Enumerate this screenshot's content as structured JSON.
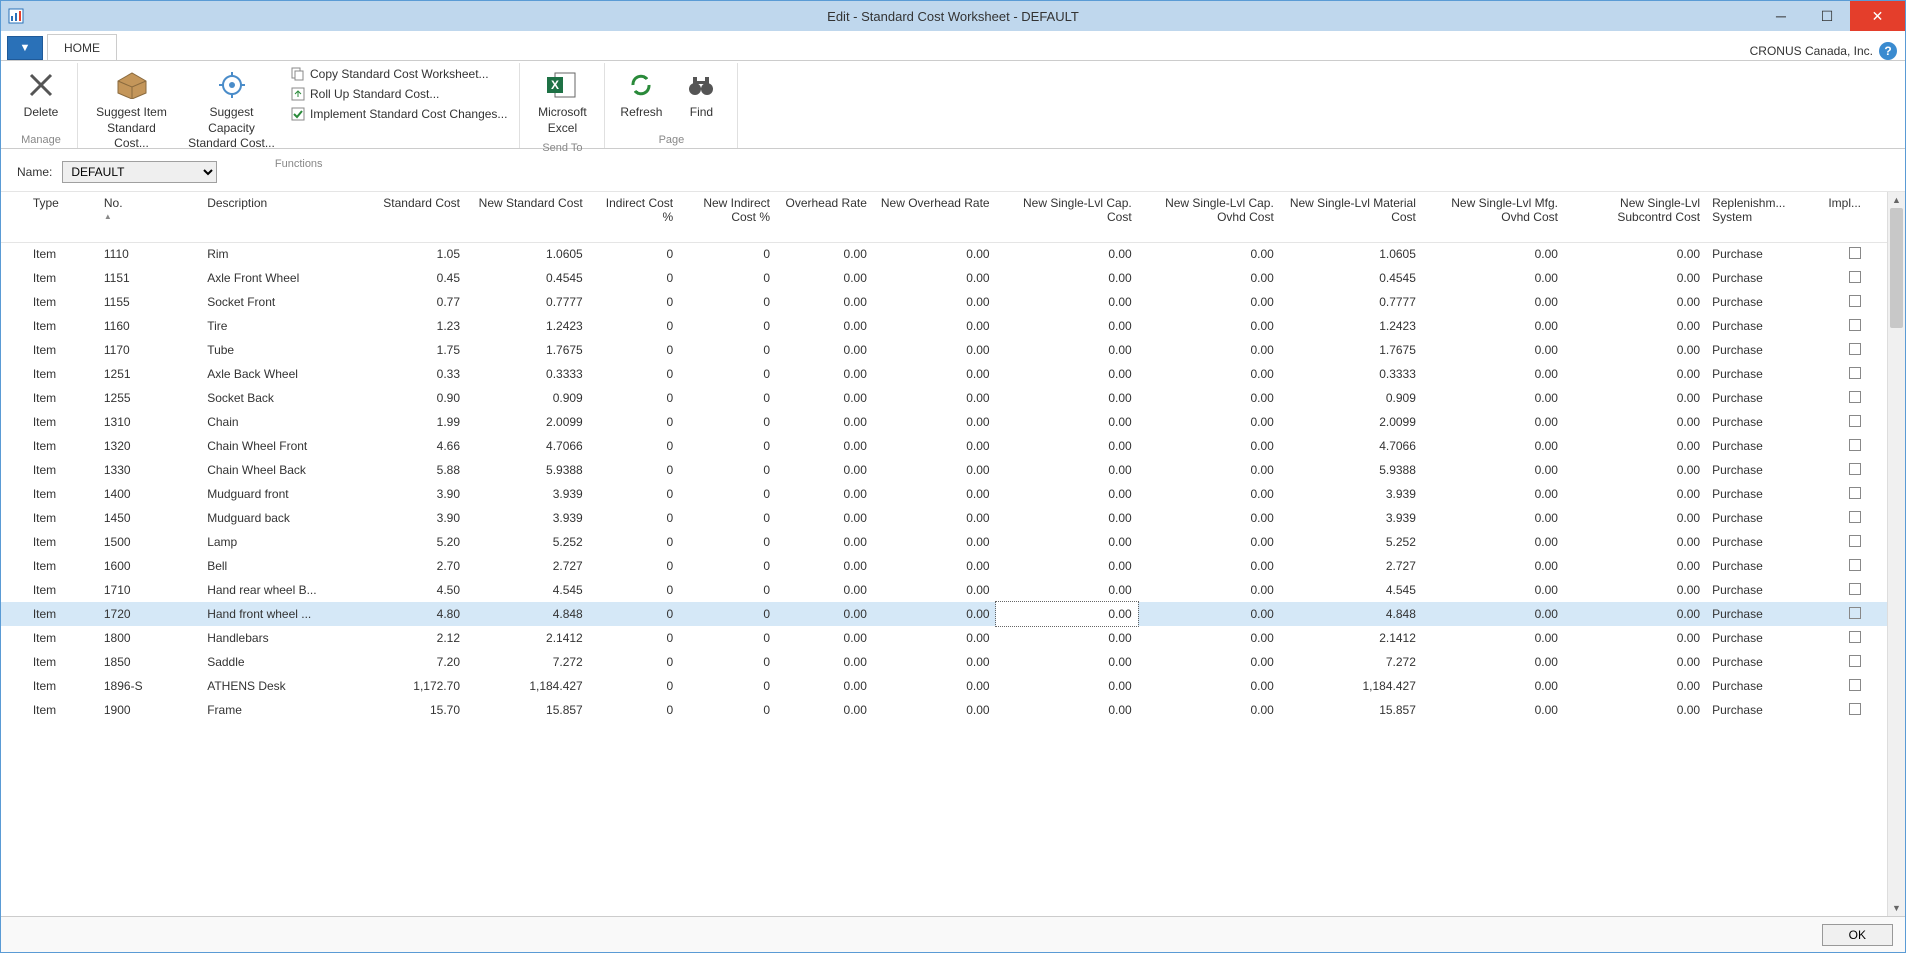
{
  "window": {
    "title": "Edit - Standard Cost Worksheet - DEFAULT"
  },
  "tabs": {
    "home": "HOME"
  },
  "company": "CRONUS Canada, Inc.",
  "ribbon": {
    "manage": {
      "label": "Manage",
      "delete": "Delete"
    },
    "functions": {
      "label": "Functions",
      "suggestItem": "Suggest Item Standard Cost...",
      "suggestCapacity": "Suggest Capacity Standard Cost...",
      "copy": "Copy Standard Cost Worksheet...",
      "rollup": "Roll Up Standard Cost...",
      "implement": "Implement Standard Cost Changes..."
    },
    "sendto": {
      "label": "Send To",
      "excel": "Microsoft Excel"
    },
    "page": {
      "label": "Page",
      "refresh": "Refresh",
      "find": "Find"
    }
  },
  "filter": {
    "nameLabel": "Name:",
    "nameValue": "DEFAULT"
  },
  "columns": {
    "type": "Type",
    "no": "No.",
    "desc": "Description",
    "stdCost": "Standard Cost",
    "newStdCost": "New Standard Cost",
    "indCost": "Indirect Cost %",
    "newIndCost": "New Indirect Cost %",
    "ovhRate": "Overhead Rate",
    "newOvhRate": "New Overhead Rate",
    "newCap": "New Single-Lvl Cap. Cost",
    "newCapOvhd": "New Single-Lvl Cap. Ovhd Cost",
    "newMat": "New Single-Lvl Material Cost",
    "newMfgOvhd": "New Single-Lvl Mfg. Ovhd Cost",
    "newSub": "New Single-Lvl Subcontrd Cost",
    "replen": "Replenishm... System",
    "impl": "Impl..."
  },
  "rows": [
    {
      "type": "Item",
      "no": "1110",
      "desc": "Rim",
      "std": "1.05",
      "nstd": "1.0605",
      "ind": "0",
      "nind": "0",
      "ovh": "0.00",
      "novh": "0.00",
      "ncap": "0.00",
      "ncapo": "0.00",
      "nmat": "1.0605",
      "nmfg": "0.00",
      "nsub": "0.00",
      "rep": "Purchase"
    },
    {
      "type": "Item",
      "no": "1151",
      "desc": "Axle Front Wheel",
      "std": "0.45",
      "nstd": "0.4545",
      "ind": "0",
      "nind": "0",
      "ovh": "0.00",
      "novh": "0.00",
      "ncap": "0.00",
      "ncapo": "0.00",
      "nmat": "0.4545",
      "nmfg": "0.00",
      "nsub": "0.00",
      "rep": "Purchase"
    },
    {
      "type": "Item",
      "no": "1155",
      "desc": "Socket Front",
      "std": "0.77",
      "nstd": "0.7777",
      "ind": "0",
      "nind": "0",
      "ovh": "0.00",
      "novh": "0.00",
      "ncap": "0.00",
      "ncapo": "0.00",
      "nmat": "0.7777",
      "nmfg": "0.00",
      "nsub": "0.00",
      "rep": "Purchase"
    },
    {
      "type": "Item",
      "no": "1160",
      "desc": "Tire",
      "std": "1.23",
      "nstd": "1.2423",
      "ind": "0",
      "nind": "0",
      "ovh": "0.00",
      "novh": "0.00",
      "ncap": "0.00",
      "ncapo": "0.00",
      "nmat": "1.2423",
      "nmfg": "0.00",
      "nsub": "0.00",
      "rep": "Purchase"
    },
    {
      "type": "Item",
      "no": "1170",
      "desc": "Tube",
      "std": "1.75",
      "nstd": "1.7675",
      "ind": "0",
      "nind": "0",
      "ovh": "0.00",
      "novh": "0.00",
      "ncap": "0.00",
      "ncapo": "0.00",
      "nmat": "1.7675",
      "nmfg": "0.00",
      "nsub": "0.00",
      "rep": "Purchase"
    },
    {
      "type": "Item",
      "no": "1251",
      "desc": "Axle Back Wheel",
      "std": "0.33",
      "nstd": "0.3333",
      "ind": "0",
      "nind": "0",
      "ovh": "0.00",
      "novh": "0.00",
      "ncap": "0.00",
      "ncapo": "0.00",
      "nmat": "0.3333",
      "nmfg": "0.00",
      "nsub": "0.00",
      "rep": "Purchase"
    },
    {
      "type": "Item",
      "no": "1255",
      "desc": "Socket Back",
      "std": "0.90",
      "nstd": "0.909",
      "ind": "0",
      "nind": "0",
      "ovh": "0.00",
      "novh": "0.00",
      "ncap": "0.00",
      "ncapo": "0.00",
      "nmat": "0.909",
      "nmfg": "0.00",
      "nsub": "0.00",
      "rep": "Purchase"
    },
    {
      "type": "Item",
      "no": "1310",
      "desc": "Chain",
      "std": "1.99",
      "nstd": "2.0099",
      "ind": "0",
      "nind": "0",
      "ovh": "0.00",
      "novh": "0.00",
      "ncap": "0.00",
      "ncapo": "0.00",
      "nmat": "2.0099",
      "nmfg": "0.00",
      "nsub": "0.00",
      "rep": "Purchase"
    },
    {
      "type": "Item",
      "no": "1320",
      "desc": "Chain Wheel Front",
      "std": "4.66",
      "nstd": "4.7066",
      "ind": "0",
      "nind": "0",
      "ovh": "0.00",
      "novh": "0.00",
      "ncap": "0.00",
      "ncapo": "0.00",
      "nmat": "4.7066",
      "nmfg": "0.00",
      "nsub": "0.00",
      "rep": "Purchase"
    },
    {
      "type": "Item",
      "no": "1330",
      "desc": "Chain Wheel Back",
      "std": "5.88",
      "nstd": "5.9388",
      "ind": "0",
      "nind": "0",
      "ovh": "0.00",
      "novh": "0.00",
      "ncap": "0.00",
      "ncapo": "0.00",
      "nmat": "5.9388",
      "nmfg": "0.00",
      "nsub": "0.00",
      "rep": "Purchase"
    },
    {
      "type": "Item",
      "no": "1400",
      "desc": "Mudguard front",
      "std": "3.90",
      "nstd": "3.939",
      "ind": "0",
      "nind": "0",
      "ovh": "0.00",
      "novh": "0.00",
      "ncap": "0.00",
      "ncapo": "0.00",
      "nmat": "3.939",
      "nmfg": "0.00",
      "nsub": "0.00",
      "rep": "Purchase"
    },
    {
      "type": "Item",
      "no": "1450",
      "desc": "Mudguard back",
      "std": "3.90",
      "nstd": "3.939",
      "ind": "0",
      "nind": "0",
      "ovh": "0.00",
      "novh": "0.00",
      "ncap": "0.00",
      "ncapo": "0.00",
      "nmat": "3.939",
      "nmfg": "0.00",
      "nsub": "0.00",
      "rep": "Purchase"
    },
    {
      "type": "Item",
      "no": "1500",
      "desc": "Lamp",
      "std": "5.20",
      "nstd": "5.252",
      "ind": "0",
      "nind": "0",
      "ovh": "0.00",
      "novh": "0.00",
      "ncap": "0.00",
      "ncapo": "0.00",
      "nmat": "5.252",
      "nmfg": "0.00",
      "nsub": "0.00",
      "rep": "Purchase"
    },
    {
      "type": "Item",
      "no": "1600",
      "desc": "Bell",
      "std": "2.70",
      "nstd": "2.727",
      "ind": "0",
      "nind": "0",
      "ovh": "0.00",
      "novh": "0.00",
      "ncap": "0.00",
      "ncapo": "0.00",
      "nmat": "2.727",
      "nmfg": "0.00",
      "nsub": "0.00",
      "rep": "Purchase"
    },
    {
      "type": "Item",
      "no": "1710",
      "desc": "Hand rear wheel B...",
      "std": "4.50",
      "nstd": "4.545",
      "ind": "0",
      "nind": "0",
      "ovh": "0.00",
      "novh": "0.00",
      "ncap": "0.00",
      "ncapo": "0.00",
      "nmat": "4.545",
      "nmfg": "0.00",
      "nsub": "0.00",
      "rep": "Purchase"
    },
    {
      "type": "Item",
      "no": "1720",
      "desc": "Hand front wheel ...",
      "std": "4.80",
      "nstd": "4.848",
      "ind": "0",
      "nind": "0",
      "ovh": "0.00",
      "novh": "0.00",
      "ncap": "0.00",
      "ncapo": "0.00",
      "nmat": "4.848",
      "nmfg": "0.00",
      "nsub": "0.00",
      "rep": "Purchase",
      "selected": true,
      "focusedCol": "ncap"
    },
    {
      "type": "Item",
      "no": "1800",
      "desc": "Handlebars",
      "std": "2.12",
      "nstd": "2.1412",
      "ind": "0",
      "nind": "0",
      "ovh": "0.00",
      "novh": "0.00",
      "ncap": "0.00",
      "ncapo": "0.00",
      "nmat": "2.1412",
      "nmfg": "0.00",
      "nsub": "0.00",
      "rep": "Purchase"
    },
    {
      "type": "Item",
      "no": "1850",
      "desc": "Saddle",
      "std": "7.20",
      "nstd": "7.272",
      "ind": "0",
      "nind": "0",
      "ovh": "0.00",
      "novh": "0.00",
      "ncap": "0.00",
      "ncapo": "0.00",
      "nmat": "7.272",
      "nmfg": "0.00",
      "nsub": "0.00",
      "rep": "Purchase"
    },
    {
      "type": "Item",
      "no": "1896-S",
      "desc": "ATHENS Desk",
      "std": "1,172.70",
      "nstd": "1,184.427",
      "ind": "0",
      "nind": "0",
      "ovh": "0.00",
      "novh": "0.00",
      "ncap": "0.00",
      "ncapo": "0.00",
      "nmat": "1,184.427",
      "nmfg": "0.00",
      "nsub": "0.00",
      "rep": "Purchase"
    },
    {
      "type": "Item",
      "no": "1900",
      "desc": "Frame",
      "std": "15.70",
      "nstd": "15.857",
      "ind": "0",
      "nind": "0",
      "ovh": "0.00",
      "novh": "0.00",
      "ncap": "0.00",
      "ncapo": "0.00",
      "nmat": "15.857",
      "nmfg": "0.00",
      "nsub": "0.00",
      "rep": "Purchase"
    }
  ],
  "footer": {
    "ok": "OK"
  }
}
